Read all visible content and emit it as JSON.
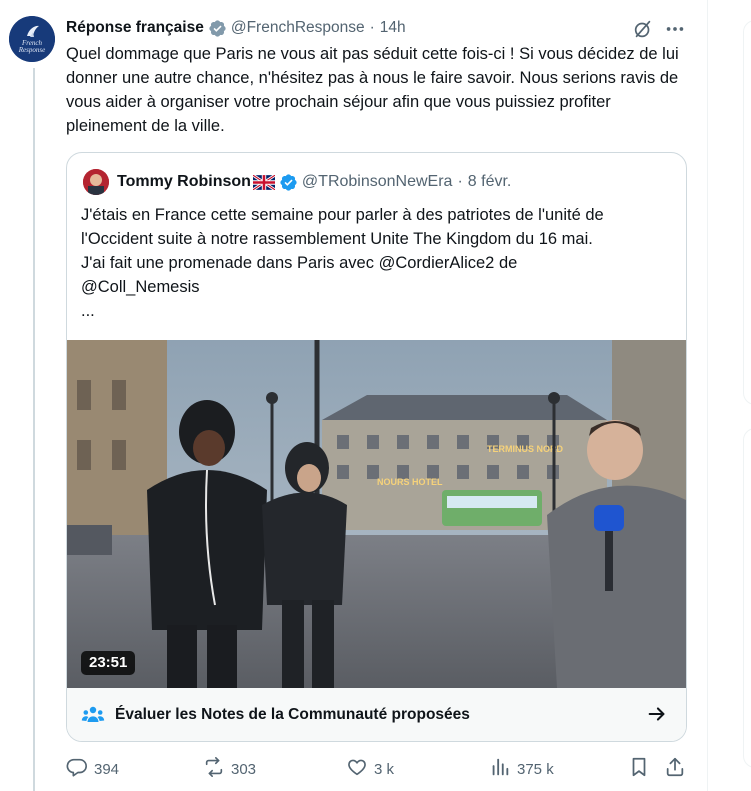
{
  "tweet": {
    "author_name": "Réponse française",
    "author_handle": "@FrenchResponse",
    "separator": "·",
    "time": "14h",
    "avatar_label": "French Response",
    "text": "Quel dommage que Paris ne vous ait pas séduit cette fois-ci ! Si vous décidez de lui donner une autre chance, n'hésitez pas à nous le faire savoir. Nous serions ravis de vous aider à organiser votre prochain séjour afin que vous puissiez profiter pleinement de la ville."
  },
  "quote": {
    "author_name": "Tommy Robinson",
    "flag_icon": "uk-flag-icon",
    "author_handle": "@TRobinsonNewEra",
    "separator": "·",
    "date": "8 févr.",
    "text_lines": [
      "J'étais en France cette semaine pour parler à des patriotes de l'unité de",
      "l'Occident suite à notre rassemblement Unite The Kingdom du 16 mai.",
      "J'ai fait une promenade dans Paris avec @CordierAlice2 de",
      "@Coll_Nemesis",
      "..."
    ],
    "video": {
      "duration": "23:51",
      "sign_left": "NOURS HOTEL",
      "sign_right": "TERMINUS NORD"
    },
    "community_notes": {
      "label": "Évaluer les Notes de la Communauté proposées"
    }
  },
  "actions": {
    "replies": "394",
    "reposts": "303",
    "likes": "3 k",
    "views": "375 k"
  },
  "colors": {
    "text": "#0f1419",
    "secondary": "#536471",
    "verified": "#1d9bf0",
    "verified_gray": "#829aab",
    "border": "#cfd9de",
    "notes_bg": "#f7f9f9"
  }
}
